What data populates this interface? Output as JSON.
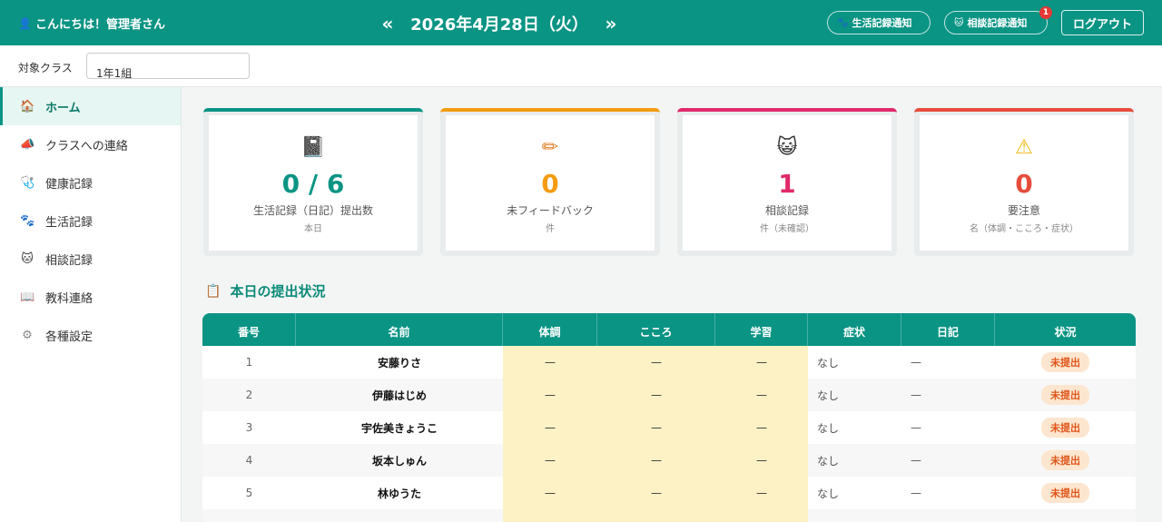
{
  "header": {
    "greeting": "こんにちは！管理者さん",
    "prev": "«",
    "date": "2026年4月28日（火）",
    "next": "»",
    "life_notify": "生活記録通知",
    "cons_notify": "相談記録通知",
    "cons_badge": "1",
    "logout": "ログアウト"
  },
  "classbar": {
    "label": "対象クラス",
    "value": "1年1組"
  },
  "sidebar": {
    "items": [
      {
        "label": "ホーム",
        "icon": "🏠"
      },
      {
        "label": "クラスへの連絡",
        "icon": "📣"
      },
      {
        "label": "健康記録",
        "icon": "🩺"
      },
      {
        "label": "生活記録",
        "icon": "🐾"
      },
      {
        "label": "相談記録",
        "icon": "🐱"
      },
      {
        "label": "教科連絡",
        "icon": "📖"
      },
      {
        "label": "各種設定",
        "icon": "⚙"
      }
    ]
  },
  "cards": [
    {
      "icon": "📓",
      "value": "0 / 6",
      "label": "生活記録（日記）提出数",
      "sub": "本日",
      "color": "#0a9484"
    },
    {
      "icon": "✏",
      "value": "0",
      "label": "未フィードバック",
      "sub": "件",
      "color": "#f39c12"
    },
    {
      "icon": "😺",
      "value": "1",
      "label": "相談記録",
      "sub": "件（未確認）",
      "color": "#e0296b"
    },
    {
      "icon": "⚠",
      "value": "0",
      "label": "要注意",
      "sub": "名（体調・こころ・症状）",
      "color": "#e74c3c"
    }
  ],
  "section": {
    "icon": "📋",
    "title": "本日の提出状況"
  },
  "table": {
    "headers": [
      "番号",
      "名前",
      "体調",
      "こころ",
      "学習",
      "症状",
      "日記",
      "状況"
    ],
    "rows": [
      {
        "no": "1",
        "name": "安藤りさ",
        "body": "—",
        "heart": "—",
        "study": "—",
        "symptom": "なし",
        "diary": "—",
        "status": "未提出"
      },
      {
        "no": "2",
        "name": "伊藤はじめ",
        "body": "—",
        "heart": "—",
        "study": "—",
        "symptom": "なし",
        "diary": "—",
        "status": "未提出"
      },
      {
        "no": "3",
        "name": "宇佐美きょうこ",
        "body": "—",
        "heart": "—",
        "study": "—",
        "symptom": "なし",
        "diary": "—",
        "status": "未提出"
      },
      {
        "no": "4",
        "name": "坂本しゅん",
        "body": "—",
        "heart": "—",
        "study": "—",
        "symptom": "なし",
        "diary": "—",
        "status": "未提出"
      },
      {
        "no": "5",
        "name": "林ゆうた",
        "body": "—",
        "heart": "—",
        "study": "—",
        "symptom": "なし",
        "diary": "—",
        "status": "未提出"
      }
    ]
  }
}
